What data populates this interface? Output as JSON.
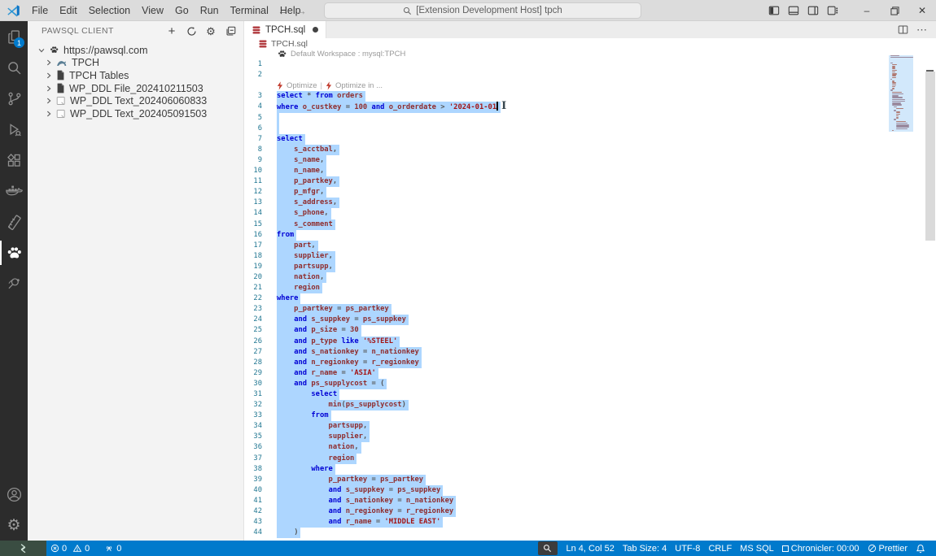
{
  "window": {
    "menus": [
      "File",
      "Edit",
      "Selection",
      "View",
      "Go",
      "Run",
      "Terminal",
      "Help"
    ],
    "command_center": "[Extension Development Host] tpch"
  },
  "activity_bar": {
    "items": [
      {
        "name": "explorer",
        "badge": "1",
        "active": false
      },
      {
        "name": "search",
        "active": false
      },
      {
        "name": "source-control",
        "active": false
      },
      {
        "name": "run-debug",
        "active": false
      },
      {
        "name": "extensions",
        "active": false
      },
      {
        "name": "docker",
        "active": false
      },
      {
        "name": "database-tools",
        "active": false
      },
      {
        "name": "pawsql",
        "active": true
      },
      {
        "name": "code-review",
        "active": false
      }
    ],
    "bottom": [
      {
        "name": "account"
      },
      {
        "name": "settings"
      }
    ]
  },
  "sidebar": {
    "title": "PAWSQL CLIENT",
    "actions": [
      "add",
      "refresh",
      "settings",
      "collapse-all"
    ],
    "tree": [
      {
        "label": "https://pawsql.com",
        "icon": "paw",
        "level": 0,
        "expanded": true
      },
      {
        "label": "TPCH",
        "icon": "mysql",
        "level": 1,
        "expanded": false
      },
      {
        "label": "TPCH Tables",
        "icon": "file-dark",
        "level": 1,
        "expanded": false
      },
      {
        "label": "WP_DDL File_202410211503",
        "icon": "file-dark",
        "level": 1,
        "expanded": false
      },
      {
        "label": "WP_DDL Text_202406060833",
        "icon": "file-light",
        "level": 1,
        "expanded": false
      },
      {
        "label": "WP_DDL Text_202405091503",
        "icon": "file-light",
        "level": 1,
        "expanded": false
      }
    ]
  },
  "editor": {
    "tab": {
      "label": "TPCH.sql",
      "modified": true
    },
    "breadcrumb": "TPCH.sql",
    "workspace_lens": "Default Workspace : mysql:TPCH",
    "codelens": {
      "optimize": "Optimize",
      "separator": "|",
      "optimize_in": "Optimize in ..."
    },
    "cursor": {
      "line": 4,
      "col": 52
    },
    "lines": [
      {
        "n": 1,
        "text": "",
        "sel": false
      },
      {
        "n": 2,
        "text": "",
        "sel": false
      },
      {
        "n": 3,
        "text": "select * from orders",
        "sel": true
      },
      {
        "n": 4,
        "text": "where o_custkey = 100 and o_orderdate > '2024-01-01",
        "sel": true,
        "caret": true
      },
      {
        "n": 5,
        "text": "",
        "sel": true
      },
      {
        "n": 6,
        "text": "",
        "sel": true
      },
      {
        "n": 7,
        "text": "select",
        "sel": true
      },
      {
        "n": 8,
        "text": "    s_acctbal,",
        "sel": true
      },
      {
        "n": 9,
        "text": "    s_name,",
        "sel": true
      },
      {
        "n": 10,
        "text": "    n_name,",
        "sel": true
      },
      {
        "n": 11,
        "text": "    p_partkey,",
        "sel": true
      },
      {
        "n": 12,
        "text": "    p_mfgr,",
        "sel": true
      },
      {
        "n": 13,
        "text": "    s_address,",
        "sel": true
      },
      {
        "n": 14,
        "text": "    s_phone,",
        "sel": true
      },
      {
        "n": 15,
        "text": "    s_comment",
        "sel": true
      },
      {
        "n": 16,
        "text": "from",
        "sel": true
      },
      {
        "n": 17,
        "text": "    part,",
        "sel": true
      },
      {
        "n": 18,
        "text": "    supplier,",
        "sel": true
      },
      {
        "n": 19,
        "text": "    partsupp,",
        "sel": true
      },
      {
        "n": 20,
        "text": "    nation,",
        "sel": true
      },
      {
        "n": 21,
        "text": "    region",
        "sel": true
      },
      {
        "n": 22,
        "text": "where",
        "sel": true
      },
      {
        "n": 23,
        "text": "    p_partkey = ps_partkey",
        "sel": true
      },
      {
        "n": 24,
        "text": "    and s_suppkey = ps_suppkey",
        "sel": true
      },
      {
        "n": 25,
        "text": "    and p_size = 30",
        "sel": true
      },
      {
        "n": 26,
        "text": "    and p_type like '%STEEL'",
        "sel": true
      },
      {
        "n": 27,
        "text": "    and s_nationkey = n_nationkey",
        "sel": true
      },
      {
        "n": 28,
        "text": "    and n_regionkey = r_regionkey",
        "sel": true
      },
      {
        "n": 29,
        "text": "    and r_name = 'ASIA'",
        "sel": true
      },
      {
        "n": 30,
        "text": "    and ps_supplycost = (",
        "sel": true
      },
      {
        "n": 31,
        "text": "        select",
        "sel": true
      },
      {
        "n": 32,
        "text": "            min(ps_supplycost)",
        "sel": true
      },
      {
        "n": 33,
        "text": "        from",
        "sel": true
      },
      {
        "n": 34,
        "text": "            partsupp,",
        "sel": true
      },
      {
        "n": 35,
        "text": "            supplier,",
        "sel": true
      },
      {
        "n": 36,
        "text": "            nation,",
        "sel": true
      },
      {
        "n": 37,
        "text": "            region",
        "sel": true
      },
      {
        "n": 38,
        "text": "        where",
        "sel": true
      },
      {
        "n": 39,
        "text": "            p_partkey = ps_partkey",
        "sel": true
      },
      {
        "n": 40,
        "text": "            and s_suppkey = ps_suppkey",
        "sel": true
      },
      {
        "n": 41,
        "text": "            and s_nationkey = n_nationkey",
        "sel": true
      },
      {
        "n": 42,
        "text": "            and n_regionkey = r_regionkey",
        "sel": true
      },
      {
        "n": 43,
        "text": "            and r_name = 'MIDDLE EAST'",
        "sel": true
      },
      {
        "n": 44,
        "text": "    )",
        "sel": true
      }
    ]
  },
  "status_bar": {
    "left": [
      {
        "name": "remote-indicator",
        "label": ""
      },
      {
        "name": "errors",
        "label": "0"
      },
      {
        "name": "warnings",
        "label": "0"
      },
      {
        "name": "ports",
        "label": "0"
      }
    ],
    "right": [
      {
        "name": "zoom-indicator",
        "label": ""
      },
      {
        "name": "cursor-position",
        "label": "Ln 4, Col 52"
      },
      {
        "name": "tab-size",
        "label": "Tab Size: 4"
      },
      {
        "name": "encoding",
        "label": "UTF-8"
      },
      {
        "name": "eol",
        "label": "CRLF"
      },
      {
        "name": "language-mode",
        "label": "MS SQL"
      },
      {
        "name": "chronicler",
        "label": "Chronicler: 00:00"
      },
      {
        "name": "prettier",
        "label": "Prettier"
      },
      {
        "name": "notifications",
        "label": ""
      }
    ]
  },
  "colors": {
    "statusbar": "#007acc",
    "selection": "#add6ff",
    "keyword": "#0000d4",
    "identifier": "#8f2d2d",
    "string": "#a31515",
    "activitybar": "#2c2c2c",
    "db_icon": "#b0383c",
    "codelens_bolt": "#c0392b"
  }
}
